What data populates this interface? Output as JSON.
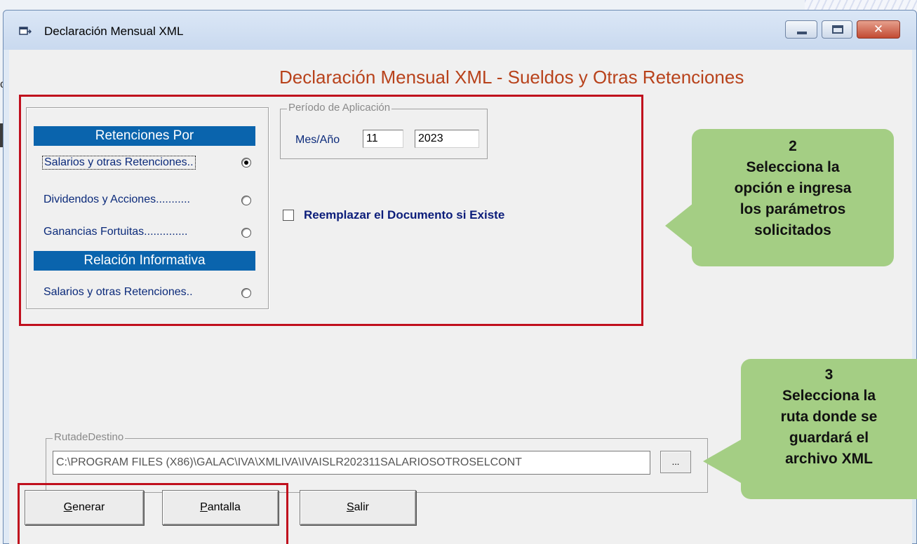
{
  "window": {
    "title": "Declaración Mensual XML"
  },
  "header": {
    "title": "Declaración Mensual XML - Sueldos y Otras Retenciones"
  },
  "retenciones": {
    "band1": "Retenciones Por",
    "band2": "Relación Informativa",
    "options": [
      {
        "label": "Salarios y otras Retenciones..",
        "selected": true
      },
      {
        "label": "Dividendos y Acciones...........",
        "selected": false
      },
      {
        "label": "Ganancias Fortuitas..............",
        "selected": false
      },
      {
        "label": "Salarios y otras Retenciones..",
        "selected": false
      }
    ]
  },
  "periodo": {
    "legend": "Período de Aplicación",
    "label": "Mes/Año",
    "month": "11",
    "year": "2023"
  },
  "reemplazar": {
    "label": "Reemplazar el Documento si Existe",
    "checked": false
  },
  "ruta": {
    "legend": "RutadeDestino",
    "value": "C:\\PROGRAM FILES (X86)\\GALAC\\IVA\\XMLIVA\\IVAISLR202311SALARIOSOTROSELCONT",
    "browse_label": "..."
  },
  "buttons": {
    "generar": {
      "underline": "G",
      "rest": "enerar"
    },
    "pantalla": {
      "underline": "P",
      "rest": "antalla"
    },
    "salir": {
      "underline": "S",
      "rest": "alir"
    }
  },
  "callouts": {
    "step2": {
      "number": "2",
      "line1": "Selecciona la",
      "line2": "opción e ingresa",
      "line3": "los parámetros",
      "line4": "solicitados"
    },
    "step3": {
      "number": "3",
      "line1": "Selecciona la",
      "line2": "ruta donde se",
      "line3": "guardará el",
      "line4": "archivo XML"
    }
  },
  "colors": {
    "accent_band": "#0a64ad",
    "title_orange": "#b8421b",
    "highlight_red": "#c00f1d",
    "callout_green": "#a4ce84"
  },
  "icons": [
    "app-window-icon",
    "minimize-icon",
    "maximize-icon",
    "close-icon"
  ]
}
